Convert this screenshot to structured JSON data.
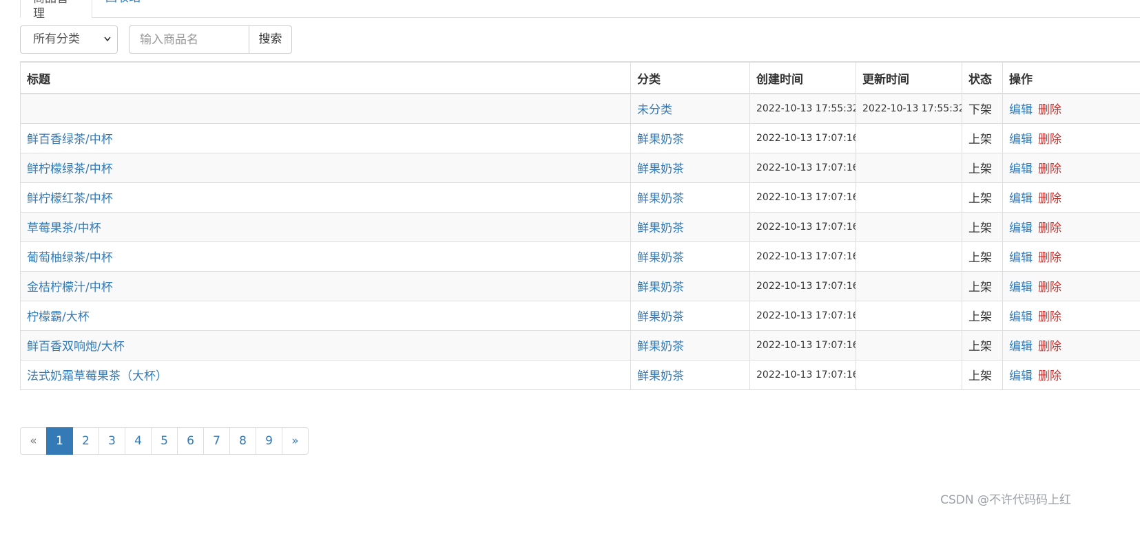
{
  "tabs": [
    {
      "label": "商品管理",
      "active": true
    },
    {
      "label": "回收站",
      "active": false
    }
  ],
  "toolbar": {
    "category_select": "所有分类",
    "search_placeholder": "输入商品名",
    "search_button": "搜索"
  },
  "table": {
    "headers": [
      "标题",
      "分类",
      "创建时间",
      "更新时间",
      "状态",
      "操作"
    ],
    "rows": [
      {
        "title": "",
        "category": "未分类",
        "created": "2022-10-13 17:55:32",
        "updated": "2022-10-13 17:55:32",
        "status": "下架",
        "edit": "编辑",
        "delete": "删除"
      },
      {
        "title": "鲜百香绿茶/中杯",
        "category": "鲜果奶茶",
        "created": "2022-10-13 17:07:16",
        "updated": "",
        "status": "上架",
        "edit": "编辑",
        "delete": "删除"
      },
      {
        "title": "鲜柠檬绿茶/中杯",
        "category": "鲜果奶茶",
        "created": "2022-10-13 17:07:16",
        "updated": "",
        "status": "上架",
        "edit": "编辑",
        "delete": "删除"
      },
      {
        "title": "鲜柠檬红茶/中杯",
        "category": "鲜果奶茶",
        "created": "2022-10-13 17:07:16",
        "updated": "",
        "status": "上架",
        "edit": "编辑",
        "delete": "删除"
      },
      {
        "title": "草莓果茶/中杯",
        "category": "鲜果奶茶",
        "created": "2022-10-13 17:07:16",
        "updated": "",
        "status": "上架",
        "edit": "编辑",
        "delete": "删除"
      },
      {
        "title": "葡萄柚绿茶/中杯",
        "category": "鲜果奶茶",
        "created": "2022-10-13 17:07:16",
        "updated": "",
        "status": "上架",
        "edit": "编辑",
        "delete": "删除"
      },
      {
        "title": "金桔柠檬汁/中杯",
        "category": "鲜果奶茶",
        "created": "2022-10-13 17:07:16",
        "updated": "",
        "status": "上架",
        "edit": "编辑",
        "delete": "删除"
      },
      {
        "title": "柠檬霸/大杯",
        "category": "鲜果奶茶",
        "created": "2022-10-13 17:07:16",
        "updated": "",
        "status": "上架",
        "edit": "编辑",
        "delete": "删除"
      },
      {
        "title": "鲜百香双响炮/大杯",
        "category": "鲜果奶茶",
        "created": "2022-10-13 17:07:16",
        "updated": "",
        "status": "上架",
        "edit": "编辑",
        "delete": "删除"
      },
      {
        "title": "法式奶霜草莓果茶（大杯）",
        "category": "鲜果奶茶",
        "created": "2022-10-13 17:07:16",
        "updated": "",
        "status": "上架",
        "edit": "编辑",
        "delete": "删除"
      }
    ]
  },
  "pagination": {
    "prev": "«",
    "pages": [
      "1",
      "2",
      "3",
      "4",
      "5",
      "6",
      "7",
      "8",
      "9"
    ],
    "current": "1",
    "next": "»"
  },
  "watermark": "CSDN @不许代码码上红",
  "colors": {
    "link": "#337ab7",
    "danger": "#c9302c",
    "active_page": "#337ab7",
    "border": "#dddddd"
  }
}
